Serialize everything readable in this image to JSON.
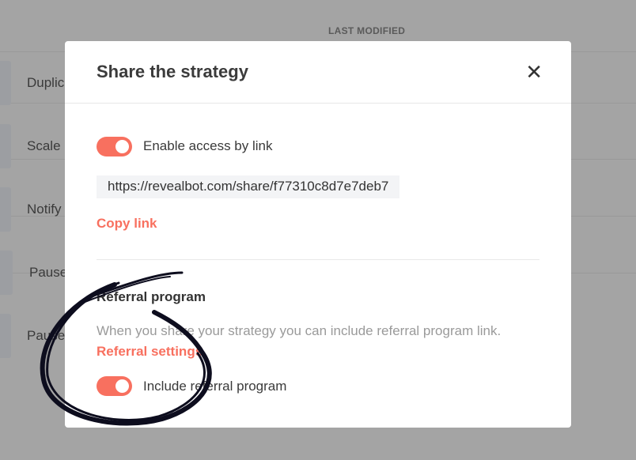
{
  "background": {
    "column_header": "LAST MODIFIED",
    "rows": [
      "Duplic",
      "Scale b",
      "Notify",
      "Pause",
      "Pause"
    ]
  },
  "modal": {
    "title": "Share the strategy",
    "close_icon": "close-icon",
    "access_toggle": {
      "label": "Enable access by link",
      "on": true
    },
    "share_url": "https://revealbot.com/share/f77310c8d7e7deb7",
    "copy_link": "Copy link",
    "referral": {
      "heading": "Referral program",
      "description": "When you share your strategy you can include referral program link.",
      "settings_link": "Referral settings",
      "toggle": {
        "label": "Include referral program",
        "on": true
      }
    }
  },
  "colors": {
    "accent": "#f8705f",
    "overlay": "#a4a4a4",
    "annotation": "#0d0d1e"
  }
}
